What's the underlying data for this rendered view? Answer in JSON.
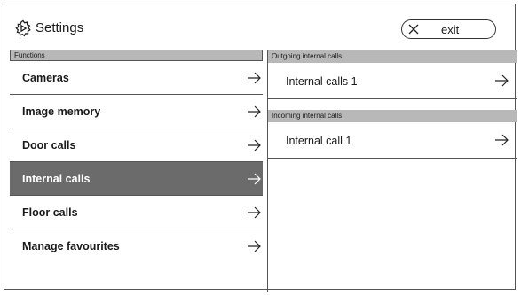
{
  "header": {
    "title": "Settings",
    "exit_label": "exit"
  },
  "left_panel": {
    "section_title": "Functions",
    "items": [
      {
        "label": "Cameras"
      },
      {
        "label": "Image memory"
      },
      {
        "label": "Door calls"
      },
      {
        "label": "Internal calls",
        "selected": true
      },
      {
        "label": "Floor calls"
      },
      {
        "label": "Manage favourites"
      }
    ]
  },
  "right_panel": {
    "outgoing_title": "Outgoing internal calls",
    "outgoing_items": [
      {
        "label": "Internal calls 1"
      }
    ],
    "incoming_title": "Incoming internal calls",
    "incoming_items": [
      {
        "label": "Internal call 1"
      }
    ]
  },
  "colors": {
    "section_bar": "#b8b8b8",
    "selected_row": "#6b6b6b",
    "border": "#555555"
  },
  "icons": {
    "settings": "gear-icon",
    "exit": "close-icon",
    "row": "arrow-right-icon"
  }
}
